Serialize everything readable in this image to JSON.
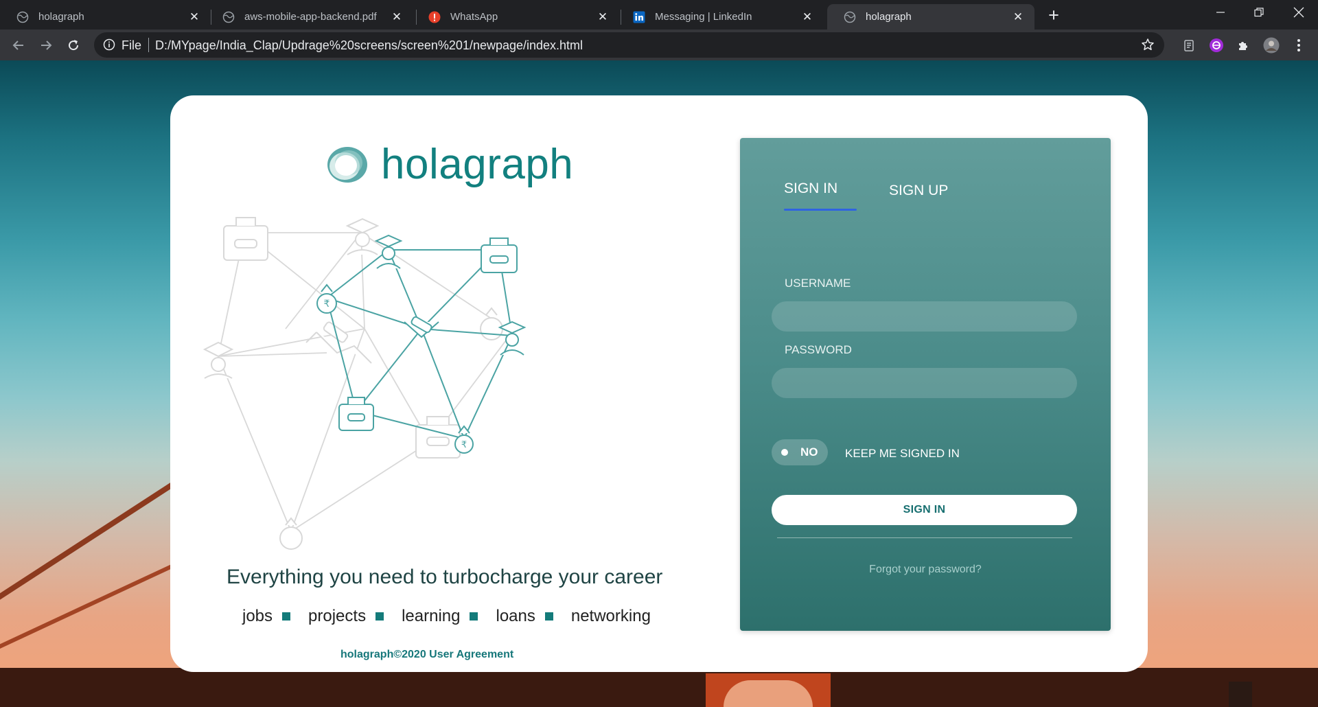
{
  "browser": {
    "tabs": [
      {
        "title": "holagraph",
        "favicon": "globe-icon"
      },
      {
        "title": "aws-mobile-app-backend.pdf",
        "favicon": "globe-icon"
      },
      {
        "title": "WhatsApp",
        "favicon": "whatsapp-alert-icon"
      },
      {
        "title": "Messaging | LinkedIn",
        "favicon": "linkedin-icon"
      },
      {
        "title": "holagraph",
        "favicon": "globe-icon",
        "active": true
      }
    ],
    "address": {
      "scheme_label": "File",
      "url": "D:/MYpage/India_Clap/Updrage%20screens/screen%201/newpage/index.html"
    }
  },
  "page": {
    "logo_text": "holagraph",
    "tagline": "Everything you need to turbocharge your career",
    "features": [
      "jobs",
      "projects",
      "learning",
      "loans",
      "networking"
    ],
    "footer_link": "holagraph©2020 User Agreement",
    "auth": {
      "tab_signin": "SIGN IN",
      "tab_signup": "SIGN UP",
      "username_label": "USERNAME",
      "username_value": "",
      "password_label": "PASSWORD",
      "password_value": "",
      "toggle_label": "NO",
      "keep_signed_in": "KEEP ME SIGNED IN",
      "signin_button": "SIGN IN",
      "forgot_password": "Forgot your password?"
    },
    "colors": {
      "brand": "#12807f",
      "panel_top": "#629d9b",
      "panel_bottom": "#2d706c",
      "active_tab_underline": "#2f63e2"
    }
  }
}
